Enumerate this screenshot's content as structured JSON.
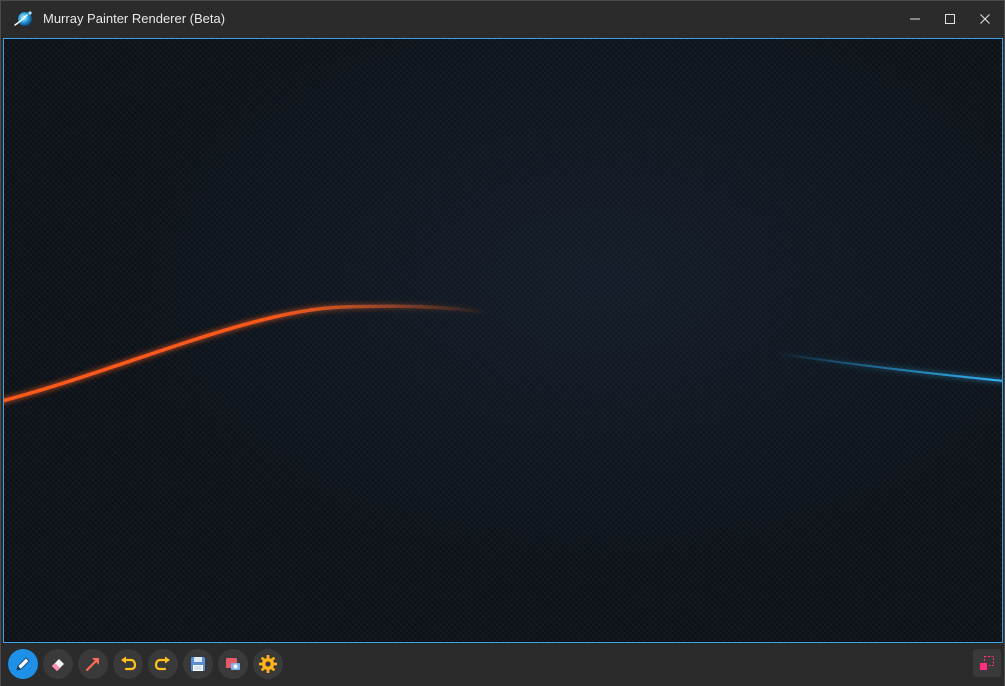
{
  "window": {
    "title": "Murray Painter Renderer (Beta)"
  },
  "colors": {
    "accent": "#3ba0e6",
    "active_tool": "#1e90e8",
    "stroke_orange": "#ff5a1a",
    "stroke_blue": "#2aa6e6"
  },
  "toolbar": {
    "tools": [
      {
        "name": "pen",
        "icon": "pencil-icon",
        "active": true
      },
      {
        "name": "eraser",
        "icon": "eraser-icon",
        "active": false
      },
      {
        "name": "arrow",
        "icon": "arrow-icon",
        "active": false
      },
      {
        "name": "undo",
        "icon": "undo-icon",
        "active": false
      },
      {
        "name": "redo",
        "icon": "redo-icon",
        "active": false
      },
      {
        "name": "save",
        "icon": "save-icon",
        "active": false
      },
      {
        "name": "screenshot",
        "icon": "screenshot-icon",
        "active": false
      },
      {
        "name": "settings",
        "icon": "gear-icon",
        "active": false
      }
    ],
    "corner_icon": "region-select-icon"
  }
}
